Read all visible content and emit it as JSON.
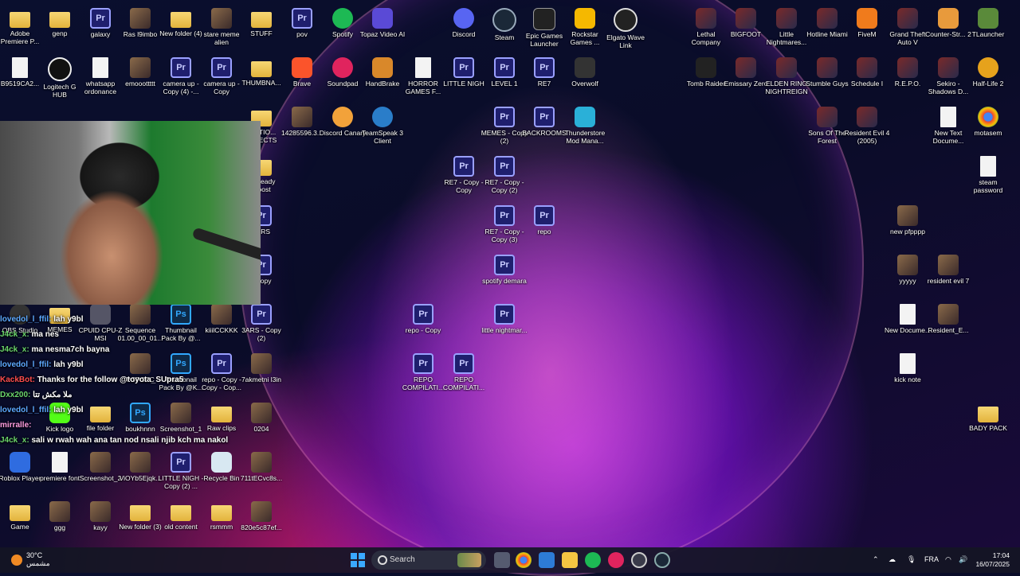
{
  "chat": [
    {
      "user": "lovedol_l_ffil",
      "msg": "lah y9bl",
      "color": "#5da9ff"
    },
    {
      "user": "J4ck_x",
      "msg": "ma nes",
      "color": "#6bd66b"
    },
    {
      "user": "J4ck_x",
      "msg": "ma nesma7ch bayna",
      "color": "#6bd66b"
    },
    {
      "user": "lovedol_l_ffil",
      "msg": "lah y9bl",
      "color": "#5da9ff"
    },
    {
      "user": "KackBot",
      "msg": "Thanks for the follow @toyota_SUpra5",
      "color": "#ff4d4d"
    },
    {
      "user": "Dxx200",
      "msg": "ملا مكش تتا",
      "color": "#6bd66b"
    },
    {
      "user": "lovedol_l_ffil",
      "msg": "lah y9bl",
      "color": "#5da9ff"
    },
    {
      "user": "mirralle",
      "msg": "",
      "color": "#ff9de0"
    },
    {
      "user": "J4ck_x",
      "msg": "sali w rwah wah ana tan nod nsali njib kch ma nakol",
      "color": "#6bd66b"
    }
  ],
  "icons": [
    {
      "label": "Adobe Premiere P...",
      "type": "folder"
    },
    {
      "label": "genp",
      "type": "folder"
    },
    {
      "label": "galaxy",
      "type": "pr"
    },
    {
      "label": "Ras l9imbo",
      "type": "img"
    },
    {
      "label": "New folder (4)",
      "type": "folder"
    },
    {
      "label": "stare meme alien",
      "type": "img"
    },
    {
      "label": "STUFF",
      "type": "folder"
    },
    {
      "label": "pov",
      "type": "pr"
    },
    {
      "label": "Spotify",
      "type": "spotify"
    },
    {
      "label": "Topaz Video AI",
      "type": "topaz"
    },
    {
      "label": "Discord",
      "type": "discord"
    },
    {
      "label": "Steam",
      "type": "steam"
    },
    {
      "label": "Epic Games Launcher",
      "type": "epic"
    },
    {
      "label": "Rockstar Games ...",
      "type": "rockstar"
    },
    {
      "label": "Elgato Wave Link",
      "type": "elgato"
    },
    {
      "label": "Lethal Company",
      "type": "game"
    },
    {
      "label": "BIGFOOT",
      "type": "game"
    },
    {
      "label": "Little Nightmares...",
      "type": "game"
    },
    {
      "label": "Hotline Miami",
      "type": "game"
    },
    {
      "label": "FiveM",
      "type": "fivem"
    },
    {
      "label": "Grand Theft Auto V",
      "type": "game"
    },
    {
      "label": "Counter-Str... 2",
      "type": "cs"
    },
    {
      "label": "TLauncher",
      "type": "mc"
    },
    {
      "label": "B9519CA2...",
      "type": "doc"
    },
    {
      "label": "Logitech G HUB",
      "type": "ghub"
    },
    {
      "label": "whatsapp ordonance",
      "type": "doc"
    },
    {
      "label": "emooottttt",
      "type": "img"
    },
    {
      "label": "camera up - Copy (4) -...",
      "type": "pr"
    },
    {
      "label": "camera up - Copy",
      "type": "pr"
    },
    {
      "label": "THUMBNA...",
      "type": "folder"
    },
    {
      "label": "Brave",
      "type": "brave"
    },
    {
      "label": "Soundpad",
      "type": "soundpad"
    },
    {
      "label": "HandBrake",
      "type": "handbrake"
    },
    {
      "label": "HORROR GAMES F...",
      "type": "doc"
    },
    {
      "label": "LITTLE NIGH",
      "type": "pr"
    },
    {
      "label": "LEVEL 1",
      "type": "pr"
    },
    {
      "label": "RE7",
      "type": "pr"
    },
    {
      "label": "Overwolf",
      "type": "overwolf"
    },
    {
      "label": "Tomb Raider",
      "type": "tr"
    },
    {
      "label": "Emissary Zero",
      "type": "game"
    },
    {
      "label": "ELDEN RING NIGHTREIGN",
      "type": "game"
    },
    {
      "label": "Stumble Guys",
      "type": "game"
    },
    {
      "label": "Schedule I",
      "type": "game"
    },
    {
      "label": "R.E.P.O.",
      "type": "game"
    },
    {
      "label": "Sekiro - Shadows D...",
      "type": "game"
    },
    {
      "label": "Half-Life 2",
      "type": "hl"
    },
    {
      "label": "Discord Canary",
      "type": "canary"
    },
    {
      "label": "TeamSpeak 3 Client",
      "type": "ts"
    },
    {
      "label": "MEMES - Copy (2)",
      "type": "pr"
    },
    {
      "label": "BACKROOMS",
      "type": "pr"
    },
    {
      "label": "Thunderstore Mod Mana...",
      "type": "thunder"
    },
    {
      "label": "Sons Of The Forest",
      "type": "game"
    },
    {
      "label": "Resident Evil 4 (2005)",
      "type": "game"
    },
    {
      "label": "New Text Docume...",
      "type": "doc"
    },
    {
      "label": "motasem",
      "type": "chrome"
    },
    {
      "label": "RE7 - Copy - Copy",
      "type": "pr"
    },
    {
      "label": "RE7 - Copy - Copy (2)",
      "type": "pr"
    },
    {
      "label": "steam password",
      "type": "doc"
    },
    {
      "label": "RE7 - Copy - Copy (3)",
      "type": "pr"
    },
    {
      "label": "repo",
      "type": "pr"
    },
    {
      "label": "new pfpppp",
      "type": "img"
    },
    {
      "label": "spotify demara",
      "type": "pr"
    },
    {
      "label": "yyyyy",
      "type": "img"
    },
    {
      "label": "resident evil 7",
      "type": "img"
    },
    {
      "label": "repo - Copy",
      "type": "pr"
    },
    {
      "label": "little nightmar...",
      "type": "pr"
    },
    {
      "label": "New Docume...",
      "type": "doc"
    },
    {
      "label": "Resident_E...",
      "type": "img"
    },
    {
      "label": "REPO COMPILATI...",
      "type": "pr"
    },
    {
      "label": "REPO COMPILATI...",
      "type": "pr"
    },
    {
      "label": "kick note",
      "type": "doc"
    },
    {
      "label": "BADY PACK",
      "type": "folder"
    },
    {
      "label": "CPUID CPU-Z MSI",
      "type": "app"
    },
    {
      "label": "Sequence 01.00_00_01...",
      "type": "img"
    },
    {
      "label": "Thumbnail Pack By @...",
      "type": "ps"
    },
    {
      "label": "kiiilCCKKK",
      "type": "img"
    },
    {
      "label": "3ARS - Copy (2)",
      "type": "pr"
    },
    {
      "label": "Thumbnail Pack By @K...",
      "type": "ps"
    },
    {
      "label": "repo - Copy - Copy - Cop...",
      "type": "pr"
    },
    {
      "label": "7akmetni l3in",
      "type": "img"
    },
    {
      "label": "PCPCPC",
      "type": "img"
    },
    {
      "label": "boukhnnn",
      "type": "ps"
    },
    {
      "label": "Screenshot_1",
      "type": "img"
    },
    {
      "label": "Raw clips",
      "type": "folder"
    },
    {
      "label": "0204",
      "type": "img"
    },
    {
      "label": "Roblox Player",
      "type": "roblox"
    },
    {
      "label": "premiere font",
      "type": "doc"
    },
    {
      "label": "Screenshot_2",
      "type": "img"
    },
    {
      "label": "ViOYb5Ejqk...",
      "type": "img"
    },
    {
      "label": "LITTLE NIGH - Copy (2) ...",
      "type": "pr"
    },
    {
      "label": "Recycle Bin",
      "type": "bin"
    },
    {
      "label": "711tECvc8s...",
      "type": "img"
    },
    {
      "label": "Game",
      "type": "folder"
    },
    {
      "label": "ggg",
      "type": "img"
    },
    {
      "label": "kayy",
      "type": "img"
    },
    {
      "label": "New folder (3)",
      "type": "folder"
    },
    {
      "label": "old content",
      "type": "folder"
    },
    {
      "label": "rsmmm",
      "type": "folder"
    },
    {
      "label": "820e5c87ef...",
      "type": "img"
    },
    {
      "label": "14285596.3...",
      "type": "img"
    },
    {
      "label": "...SITIO... EFFECTS",
      "type": "folder"
    },
    {
      "label": "...s ready ...oost",
      "type": "folder"
    },
    {
      "label": "3ARS",
      "type": "pr"
    },
    {
      "label": "- Copy",
      "type": "pr"
    },
    {
      "label": "OBS Studio",
      "type": "obs"
    },
    {
      "label": "MEMES",
      "type": "folder"
    },
    {
      "label": "Kick logo",
      "type": "kick"
    },
    {
      "label": "file folder",
      "type": "folder"
    }
  ],
  "taskbar": {
    "weather_temp": "30°C",
    "weather_desc": "مشمس",
    "search_placeholder": "Search",
    "lang": "FRA",
    "time": "17:04",
    "date": "16/07/2025"
  },
  "colors": {
    "spotify": "#1db954",
    "discord": "#5865f2",
    "brave": "#fb542b",
    "accent": "#3aa8ff"
  }
}
